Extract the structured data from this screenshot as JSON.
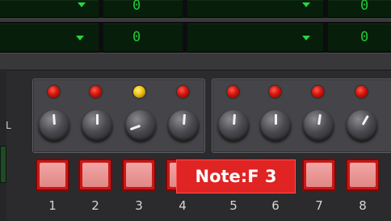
{
  "lcd_row1": {
    "left_value": "0",
    "right_value": "0"
  },
  "lcd_row2": {
    "left_value": "0",
    "right_value": "0"
  },
  "side_label": "L",
  "tooltip": "Note:F 3",
  "leds": [
    "red",
    "red",
    "yellow",
    "red",
    "red",
    "red",
    "red",
    "red"
  ],
  "steps": [
    "1",
    "2",
    "3",
    "4",
    "5",
    "6",
    "7",
    "8"
  ],
  "colors": {
    "lcd_text": "#23c83c",
    "led_red": "#d4140c",
    "led_yellow": "#f0c010",
    "step_border": "#c81818",
    "tooltip_bg": "#e02323"
  }
}
